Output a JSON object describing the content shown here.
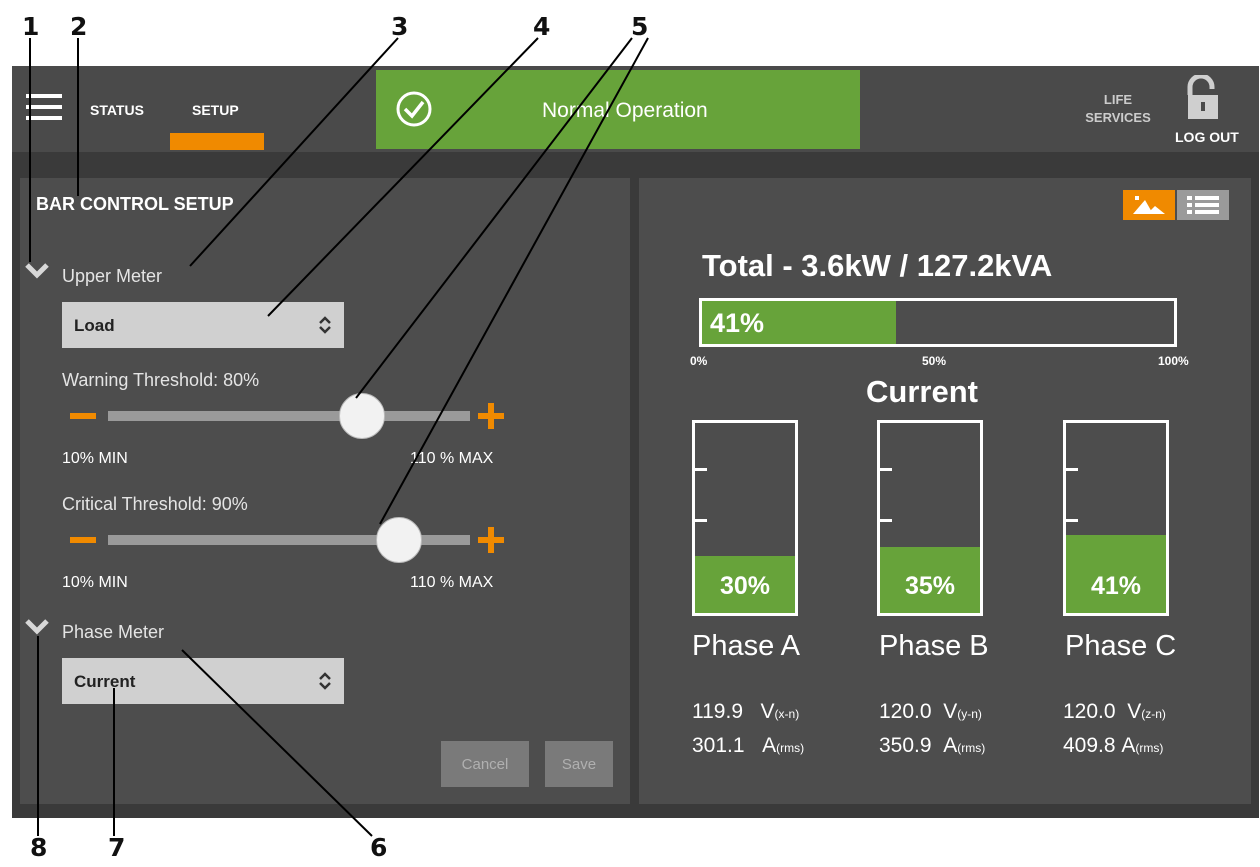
{
  "callouts": [
    "1",
    "2",
    "3",
    "4",
    "5",
    "6",
    "7",
    "8"
  ],
  "nav": {
    "status": "STATUS",
    "setup": "SETUP",
    "life": "LIFE",
    "services": "SERVICES",
    "logout": "LOG OUT"
  },
  "banner": {
    "text": "Normal Operation"
  },
  "setup": {
    "title": "BAR CONTROL SETUP",
    "upper_meter": "Upper Meter",
    "upper_select": "Load",
    "warning_label": "Warning Threshold: 80%",
    "warning_value": 80,
    "critical_label": "Critical Threshold: 90%",
    "critical_value": 90,
    "min_label": "10% MIN",
    "max_label": "110 % MAX",
    "phase_meter": "Phase Meter",
    "phase_select": "Current",
    "cancel": "Cancel",
    "save": "Save"
  },
  "total": {
    "title": "Total - 3.6kW / 127.2kVA",
    "percent_label": "41%",
    "percent": 41,
    "scale": [
      "0%",
      "50%",
      "100%"
    ]
  },
  "current_title": "Current",
  "phases": [
    {
      "name": "Phase A",
      "pct_label": "30%",
      "pct": 30,
      "v": "119.9",
      "v_unit": "V",
      "v_sub": "(x-n)",
      "a": "301.1",
      "a_unit": "A",
      "a_sub": "(rms)"
    },
    {
      "name": "Phase B",
      "pct_label": "35%",
      "pct": 35,
      "v": "120.0",
      "v_unit": "V",
      "v_sub": "(y-n)",
      "a": "350.9",
      "a_unit": "A",
      "a_sub": "(rms)"
    },
    {
      "name": "Phase C",
      "pct_label": "41%",
      "pct": 41,
      "v": "120.0",
      "v_unit": "V",
      "v_sub": "(z-n)",
      "a": "409.8",
      "a_unit": "A",
      "a_sub": "(rms)"
    }
  ],
  "colors": {
    "accent": "#f08a00",
    "ok_green": "#67a33a",
    "panel": "#4d4d4d"
  }
}
